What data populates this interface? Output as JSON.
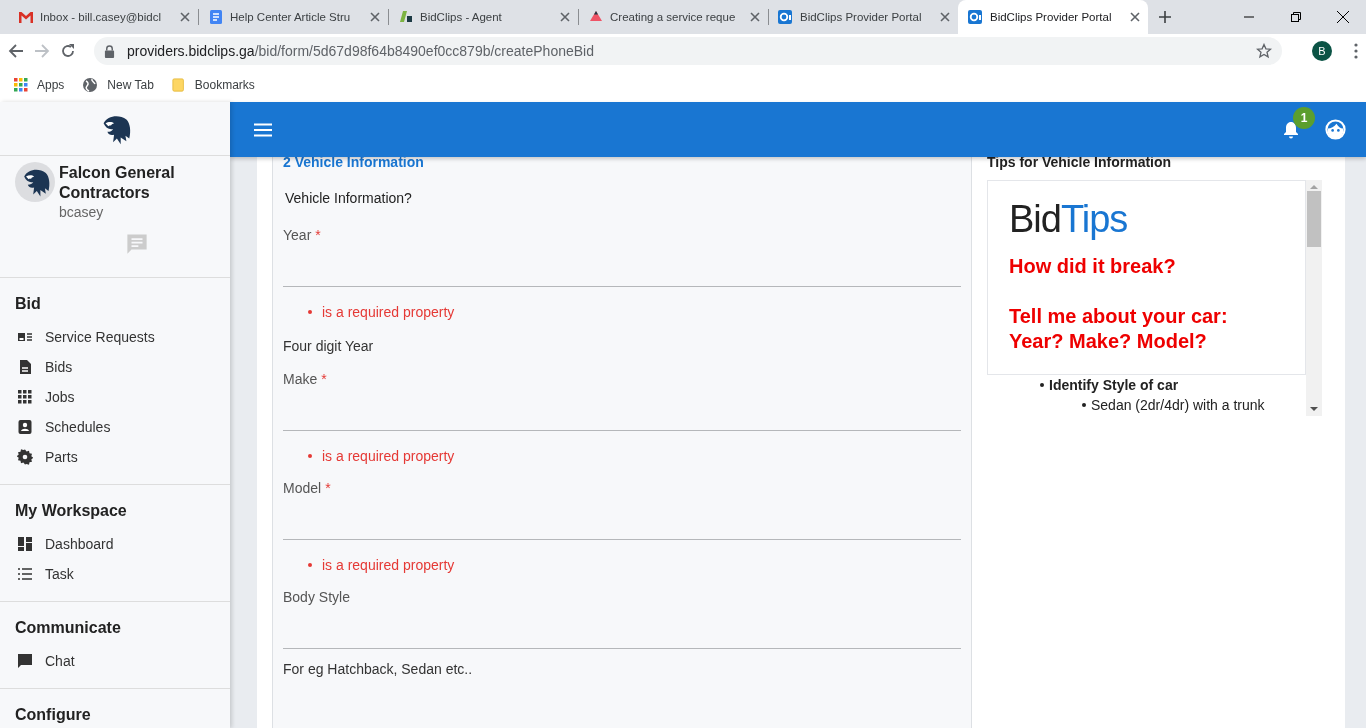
{
  "browser": {
    "tabs": [
      {
        "title": "Inbox - bill.casey@bidcl",
        "kind": "mail",
        "selected": false
      },
      {
        "title": "Help Center Article Stru",
        "kind": "doc",
        "selected": false
      },
      {
        "title": "BidClips - Agent",
        "kind": "agent",
        "selected": false
      },
      {
        "title": "Creating a service reque",
        "kind": "triangle",
        "selected": false
      },
      {
        "title": "BidClips Provider Portal",
        "kind": "portal",
        "selected": false
      },
      {
        "title": "BidClips Provider Portal",
        "kind": "portal",
        "selected": true
      }
    ],
    "address": {
      "host": "providers.bidclips.ga",
      "path": "/bid/form/5d67d98f64b8490ef0cc879b/createPhoneBid"
    },
    "profile_initial": "B",
    "bookmarks": [
      {
        "label": "Apps",
        "kind": "apps"
      },
      {
        "label": "New Tab",
        "kind": "globe"
      },
      {
        "label": "Bookmarks",
        "kind": "folder"
      }
    ]
  },
  "sidebar": {
    "company": "Falcon General Contractors",
    "username": "bcasey",
    "sections": [
      {
        "title": "Bid",
        "items": [
          "Service Requests",
          "Bids",
          "Jobs",
          "Schedules",
          "Parts"
        ]
      },
      {
        "title": "My Workspace",
        "items": [
          "Dashboard",
          "Task"
        ]
      },
      {
        "title": "Communicate",
        "items": [
          "Chat"
        ]
      },
      {
        "title": "Configure"
      }
    ]
  },
  "topbar": {
    "notification_count": "1"
  },
  "form": {
    "section_title": "2 Vehicle Information",
    "question": "Vehicle Information?",
    "required_mark": "*",
    "fields": [
      {
        "label": "Year",
        "required": true,
        "error": "is a required property",
        "help": "Four digit Year"
      },
      {
        "label": "Make",
        "required": true,
        "error": "is a required property"
      },
      {
        "label": "Model",
        "required": true,
        "error": "is a required property"
      },
      {
        "label": "Body Style",
        "required": false,
        "help": "For eg Hatchback, Sedan etc.."
      }
    ]
  },
  "tips": {
    "title": "Tips for Vehicle Information",
    "logo": {
      "dark": "Bid",
      "accent": "Tips"
    },
    "prompts": [
      "How did it break?",
      "Tell me about your car: Year? Make? Model?"
    ],
    "bullets": [
      {
        "text": "Identify Style of car",
        "children": [
          {
            "text": "Sedan (2dr/4dr) with a trunk"
          }
        ]
      }
    ]
  }
}
